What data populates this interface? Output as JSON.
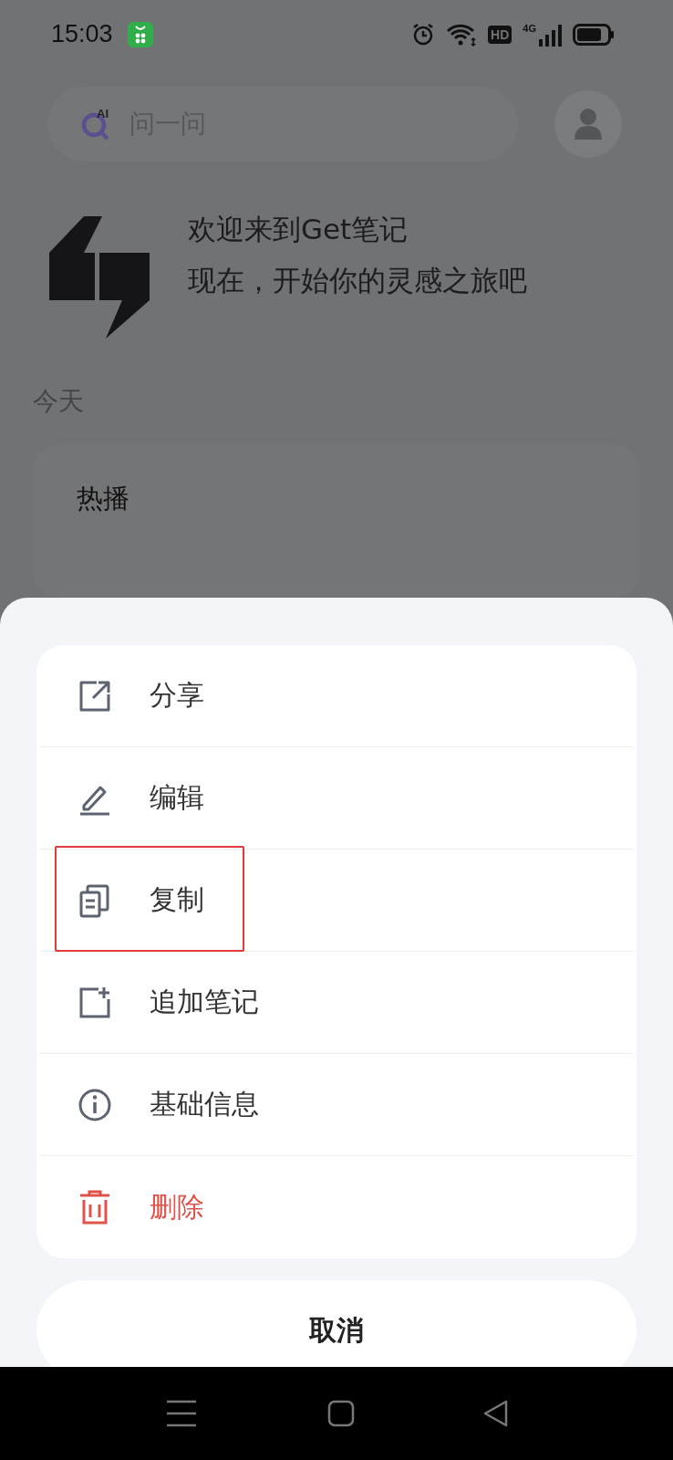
{
  "status_bar": {
    "time": "15:03",
    "hd": "HD",
    "network": "4G"
  },
  "search": {
    "placeholder": "问一问",
    "badge": "AI"
  },
  "welcome": {
    "lines": [
      "欢迎来到Get笔记",
      "现在，开始你的灵感之旅吧"
    ]
  },
  "section_title": "今天",
  "card": {
    "title": "热播"
  },
  "action_sheet": {
    "items": [
      {
        "kind": "share",
        "label": "分享",
        "danger": false,
        "highlighted": false
      },
      {
        "kind": "edit",
        "label": "编辑",
        "danger": false,
        "highlighted": false
      },
      {
        "kind": "copy",
        "label": "复制",
        "danger": false,
        "highlighted": true
      },
      {
        "kind": "append",
        "label": "追加笔记",
        "danger": false,
        "highlighted": false
      },
      {
        "kind": "info",
        "label": "基础信息",
        "danger": false,
        "highlighted": false
      },
      {
        "kind": "delete",
        "label": "删除",
        "danger": true,
        "highlighted": false
      }
    ],
    "cancel": "取消"
  }
}
